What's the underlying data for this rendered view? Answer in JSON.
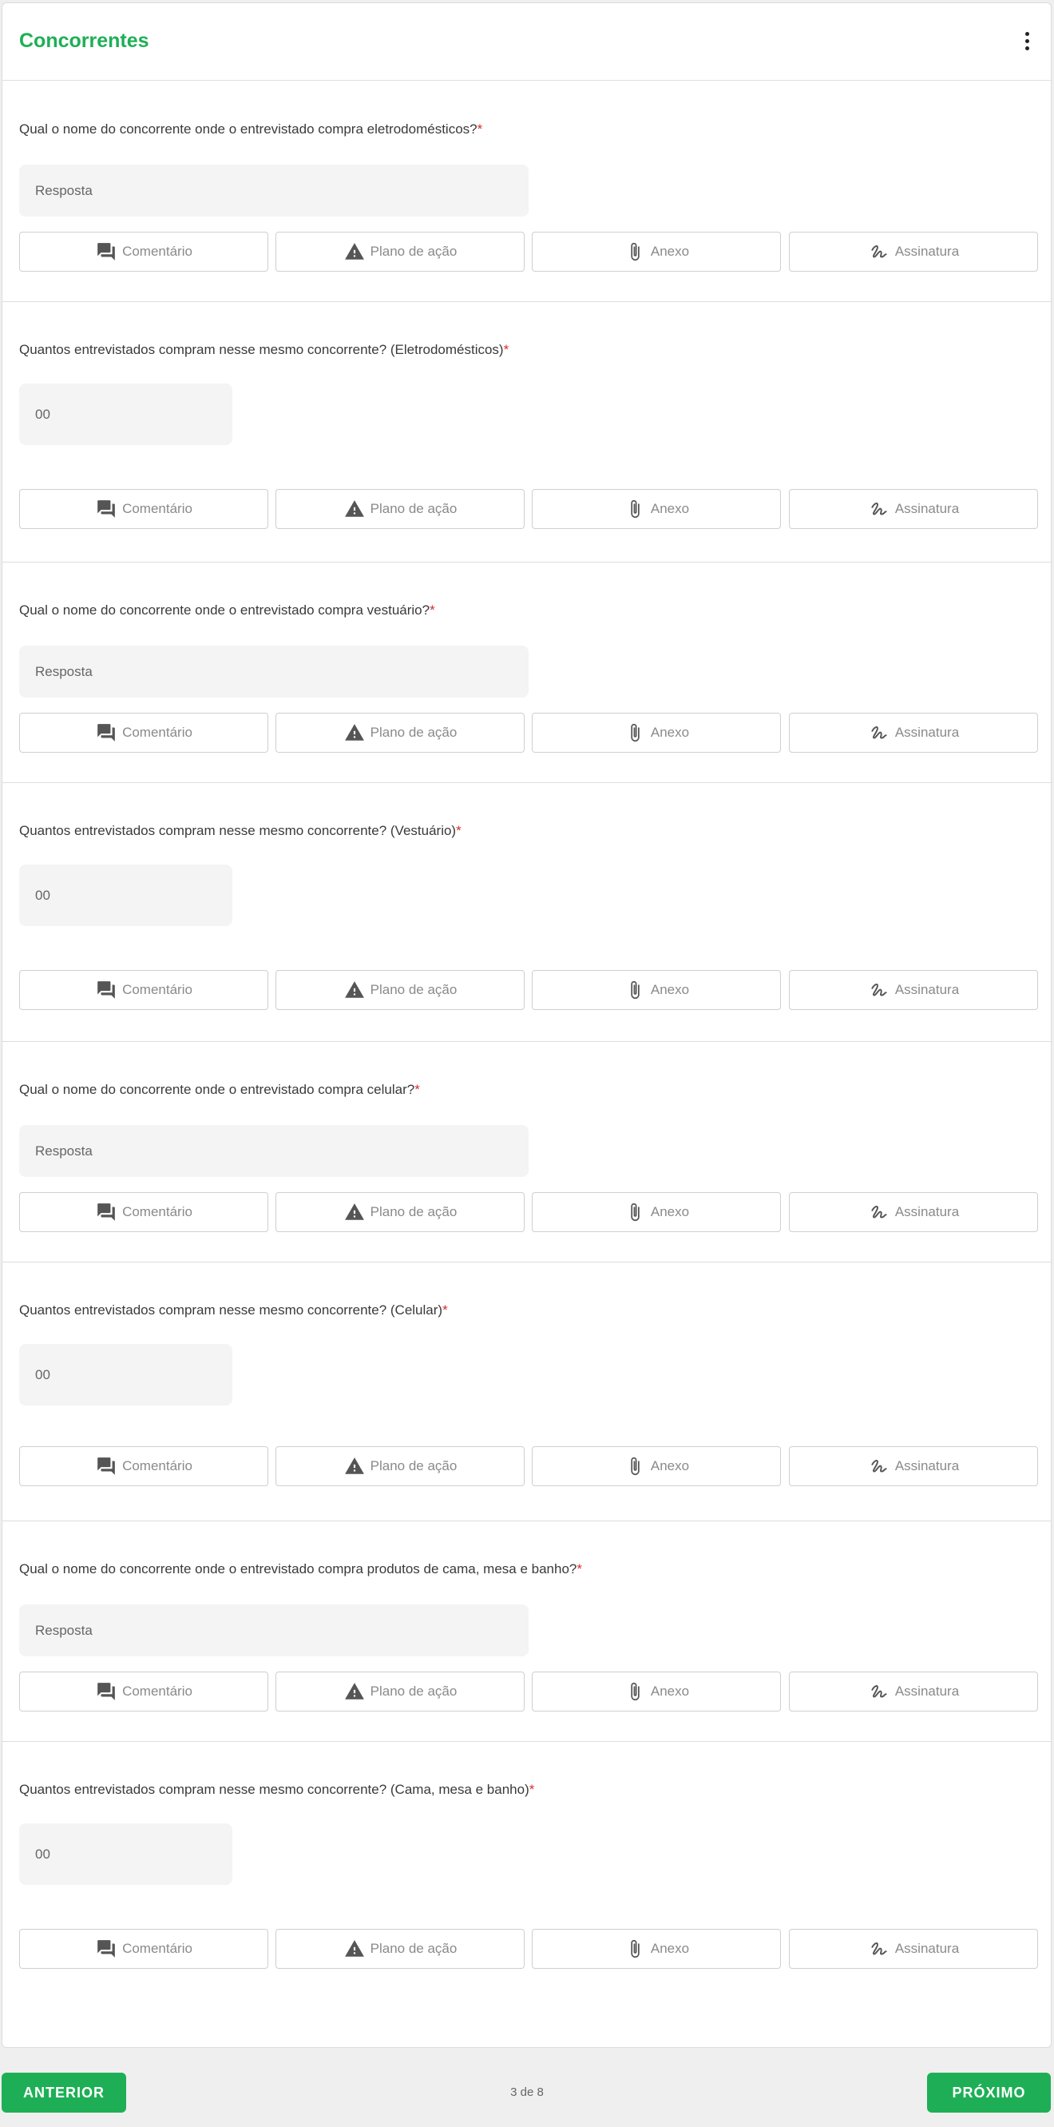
{
  "section": {
    "title": "Concorrentes",
    "menu_icon": "kebab-menu-icon"
  },
  "actions": {
    "comment": {
      "label": "Comentário",
      "icon": "comment-icon"
    },
    "action_plan": {
      "label": "Plano de ação",
      "icon": "warning-icon"
    },
    "attachment": {
      "label": "Anexo",
      "icon": "paperclip-icon"
    },
    "signature": {
      "label": "Assinatura",
      "icon": "signature-icon"
    }
  },
  "questions": [
    {
      "text": "Qual o nome do concorrente onde o entrevistado compra eletrodomésticos?",
      "required": "*",
      "type": "text",
      "placeholder": "Resposta"
    },
    {
      "text": "Quantos entrevistados compram nesse mesmo concorrente? (Eletrodomésticos)",
      "required": "*",
      "type": "number",
      "placeholder": "00"
    },
    {
      "text": "Qual o nome do concorrente onde o entrevistado compra vestuário?",
      "required": "*",
      "type": "text",
      "placeholder": "Resposta"
    },
    {
      "text": "Quantos entrevistados compram nesse mesmo concorrente? (Vestuário)",
      "required": "*",
      "type": "number",
      "placeholder": "00"
    },
    {
      "text": "Qual o nome do concorrente onde o entrevistado compra celular?",
      "required": "*",
      "type": "text",
      "placeholder": "Resposta"
    },
    {
      "text": "Quantos entrevistados compram nesse mesmo concorrente? (Celular)",
      "required": "*",
      "type": "number",
      "placeholder": "00"
    },
    {
      "text": "Qual o nome do concorrente onde o entrevistado compra produtos de cama, mesa e banho?",
      "required": "*",
      "type": "text",
      "placeholder": "Resposta"
    },
    {
      "text": "Quantos entrevistados compram nesse mesmo concorrente? (Cama, mesa e banho)",
      "required": "*",
      "type": "number",
      "placeholder": "00"
    }
  ],
  "footer": {
    "prev_label": "ANTERIOR",
    "next_label": "PRÓXIMO",
    "page_indicator": "3 de 8"
  },
  "colors": {
    "accent": "#1eaf56",
    "required": "#d32f2f",
    "input_bg": "#f4f4f4"
  }
}
